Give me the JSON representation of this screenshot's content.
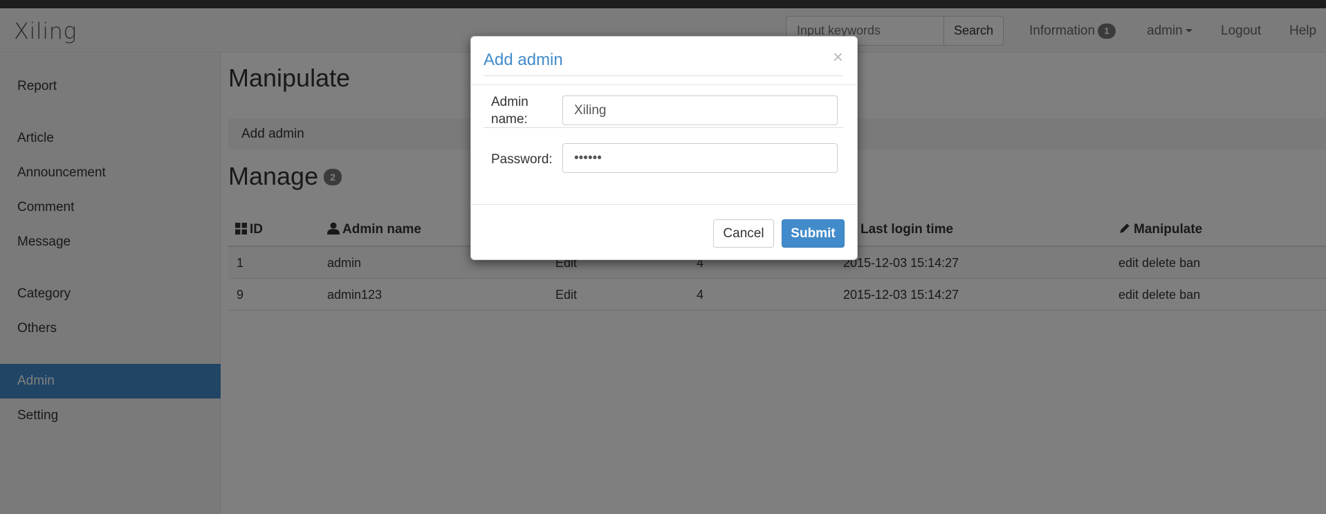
{
  "brand": "Xiling",
  "search": {
    "placeholder": "Input keywords",
    "button": "Search"
  },
  "nav": {
    "information": "Information",
    "information_count": "1",
    "user": "admin",
    "logout": "Logout",
    "help": "Help"
  },
  "sidebar": {
    "items": [
      {
        "label": "Report"
      },
      {
        "label": "Article"
      },
      {
        "label": "Announcement"
      },
      {
        "label": "Comment"
      },
      {
        "label": "Message"
      },
      {
        "label": "Category"
      },
      {
        "label": "Others"
      },
      {
        "label": "Admin",
        "active": true
      },
      {
        "label": "Setting"
      }
    ]
  },
  "main": {
    "manipulate_title": "Manipulate",
    "add_admin": "Add admin",
    "manage_title": "Manage",
    "manage_count": "2",
    "table": {
      "headers": [
        "ID",
        "Admin name",
        "Last login time",
        "Manipulate"
      ],
      "rows": [
        [
          "1",
          "admin",
          "Edit",
          "4",
          "2015-12-03 15:14:27",
          "edit delete ban"
        ],
        [
          "9",
          "admin123",
          "Edit",
          "4",
          "2015-12-03 15:14:27",
          "edit delete ban"
        ]
      ]
    }
  },
  "modal": {
    "title": "Add admin",
    "close": "×",
    "name_label": "Admin name:",
    "name_value": "Xiling",
    "password_label": "Password:",
    "password_value": "••••••",
    "cancel": "Cancel",
    "submit": "Submit"
  },
  "colors": {
    "primary": "#428bca",
    "sidebar_bg": "#f5f5f5",
    "backdrop": "rgba(0,0,0,0.5)"
  }
}
